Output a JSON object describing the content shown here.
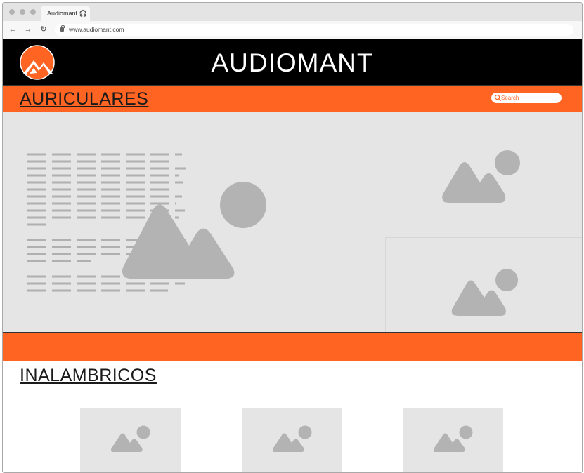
{
  "browser": {
    "tab_title": "Audiomant 🎧",
    "url": "www.audiomant.com",
    "back_glyph": "←",
    "forward_glyph": "→",
    "reload_glyph": "↻"
  },
  "header": {
    "brand": "AUDIOMANT",
    "logo_icon": "mountain-logo-icon"
  },
  "section1": {
    "title": "AURICULARES",
    "search_placeholder": "Search"
  },
  "section2": {
    "title": "INALAMBRICOS",
    "cards": [
      "image-placeholder",
      "image-placeholder",
      "image-placeholder"
    ]
  },
  "colors": {
    "accent": "#ff6422",
    "header_bg": "#000000",
    "placeholder_bg": "#e5e5e5",
    "placeholder_icon": "#b3b3b3"
  }
}
